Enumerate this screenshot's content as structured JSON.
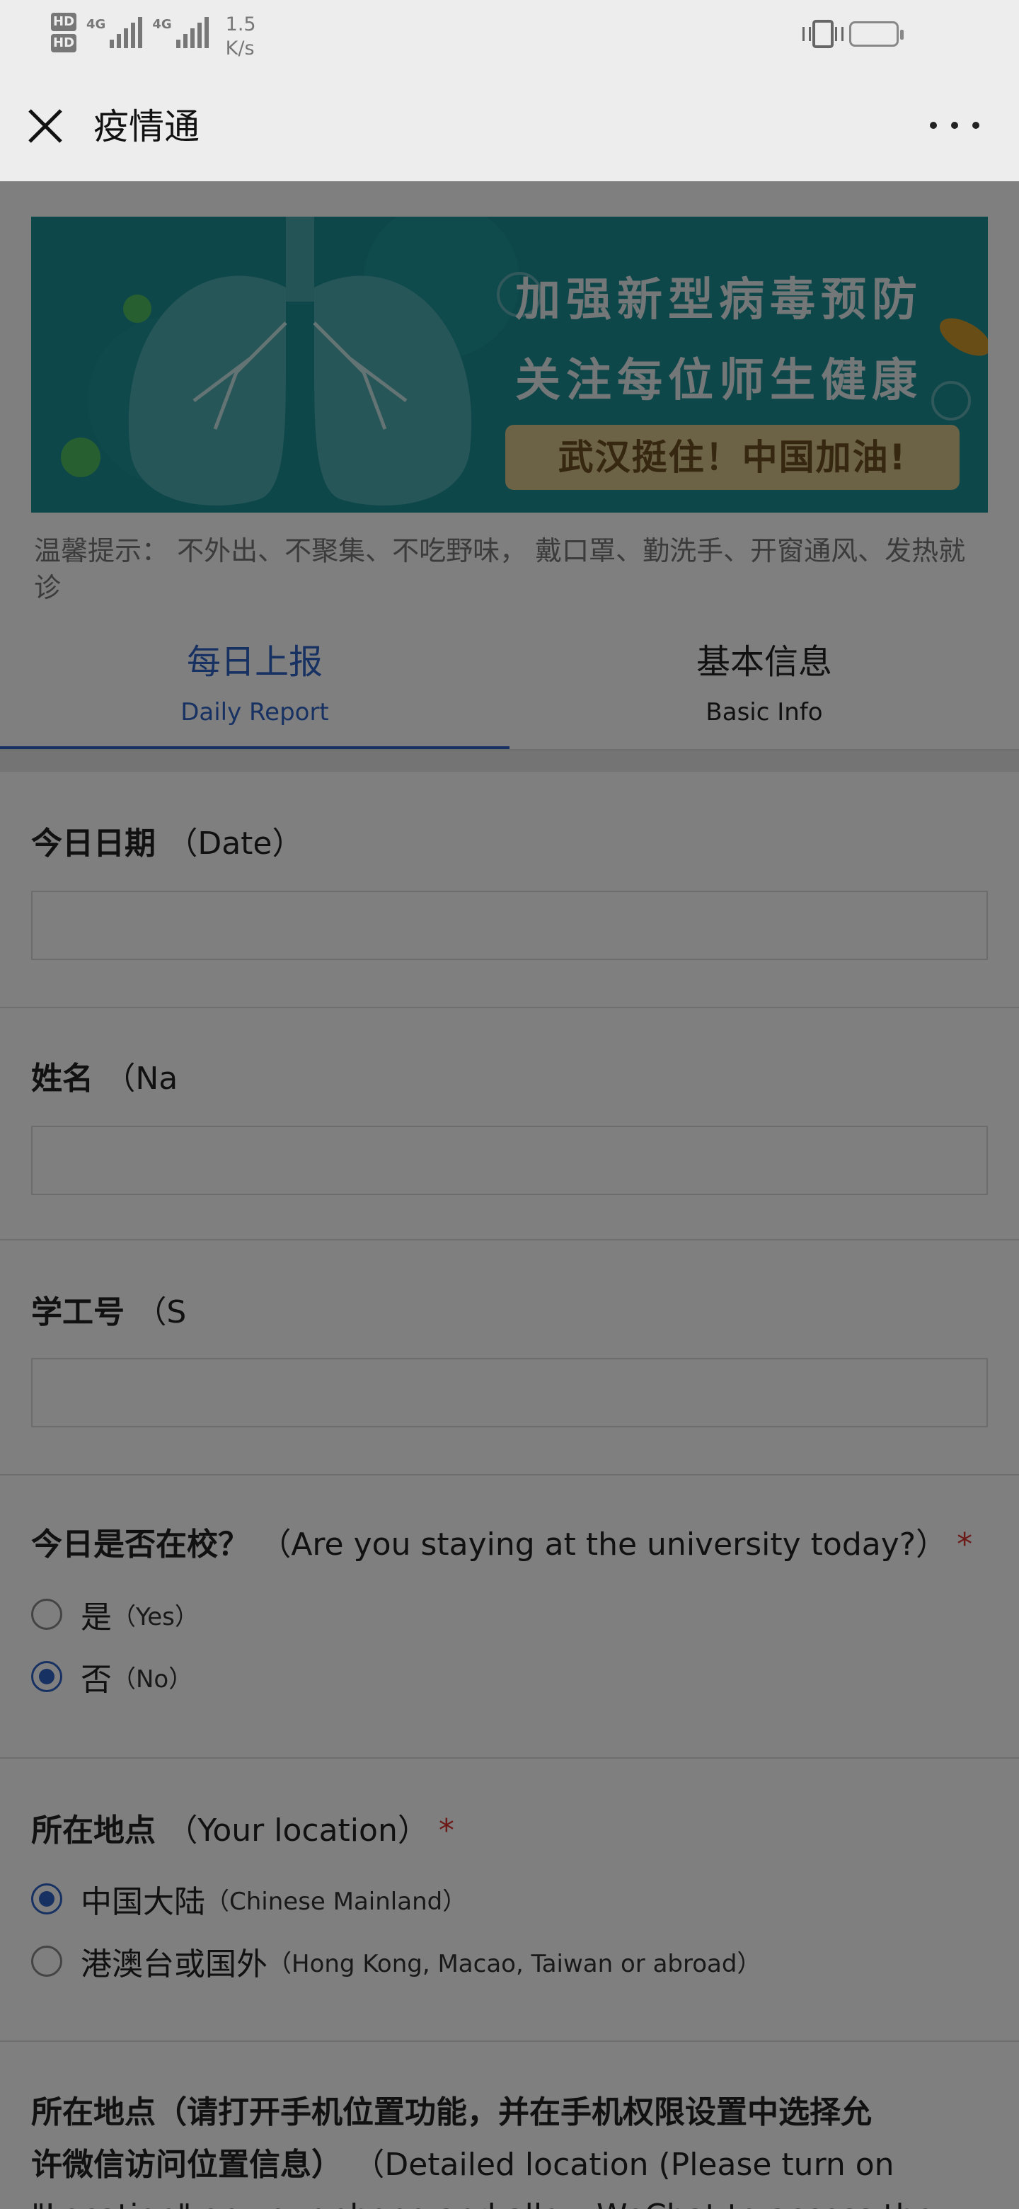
{
  "status_bar": {
    "hd1": "HD",
    "hd2": "HD",
    "net1": "4G",
    "net2": "4G",
    "speed_value": "1.5",
    "speed_unit": "K/s"
  },
  "titlebar": {
    "title": "疫情通"
  },
  "banner": {
    "line1": "加强新型病毒预防",
    "line2": "关注每位师生健康",
    "pill": "武汉挺住！中国加油!",
    "bg_color": "#1a8e93"
  },
  "tip": "温馨提示： 不外出、不聚集、不吃野味， 戴口罩、勤洗手、开窗通风、发热就诊",
  "tabs": [
    {
      "zh": "每日上报",
      "en": "Daily Report",
      "active": true
    },
    {
      "zh": "基本信息",
      "en": "Basic Info",
      "active": false
    }
  ],
  "form": {
    "date": {
      "label_zh": "今日日期",
      "label_en": "（Date）",
      "value": ""
    },
    "name": {
      "label_zh": "姓名",
      "label_en": "（Na",
      "value": ""
    },
    "id": {
      "label_zh": "学工号",
      "label_en": "（S",
      "value": ""
    },
    "on_campus": {
      "label_zh": "今日是否在校？",
      "label_en": "（Are you staying at the university today?）",
      "required": "*",
      "options": [
        {
          "zh": "是",
          "en": "（Yes）",
          "selected": false
        },
        {
          "zh": "否",
          "en": "（No）",
          "selected": true
        }
      ]
    },
    "location": {
      "label_zh": "所在地点",
      "label_en": "（Your location）",
      "required": "*",
      "options": [
        {
          "zh": "中国大陆",
          "en": "（Chinese Mainland）",
          "selected": true
        },
        {
          "zh": "港澳台或国外",
          "en": "（Hong Kong, Macao, Taiwan or abroad）",
          "selected": false
        }
      ]
    },
    "detailed_location": {
      "line1": "所在地点（请打开手机位置功能，并在手机权限设置中选择允",
      "line2_zh": "许微信访问位置信息）",
      "line2_en": "（Detailed location (Please turn on",
      "line3": "\"Location\" on your phone and allow WeChat to access the"
    }
  },
  "colors": {
    "accent": "#2f63c4",
    "required": "#d8322f"
  }
}
